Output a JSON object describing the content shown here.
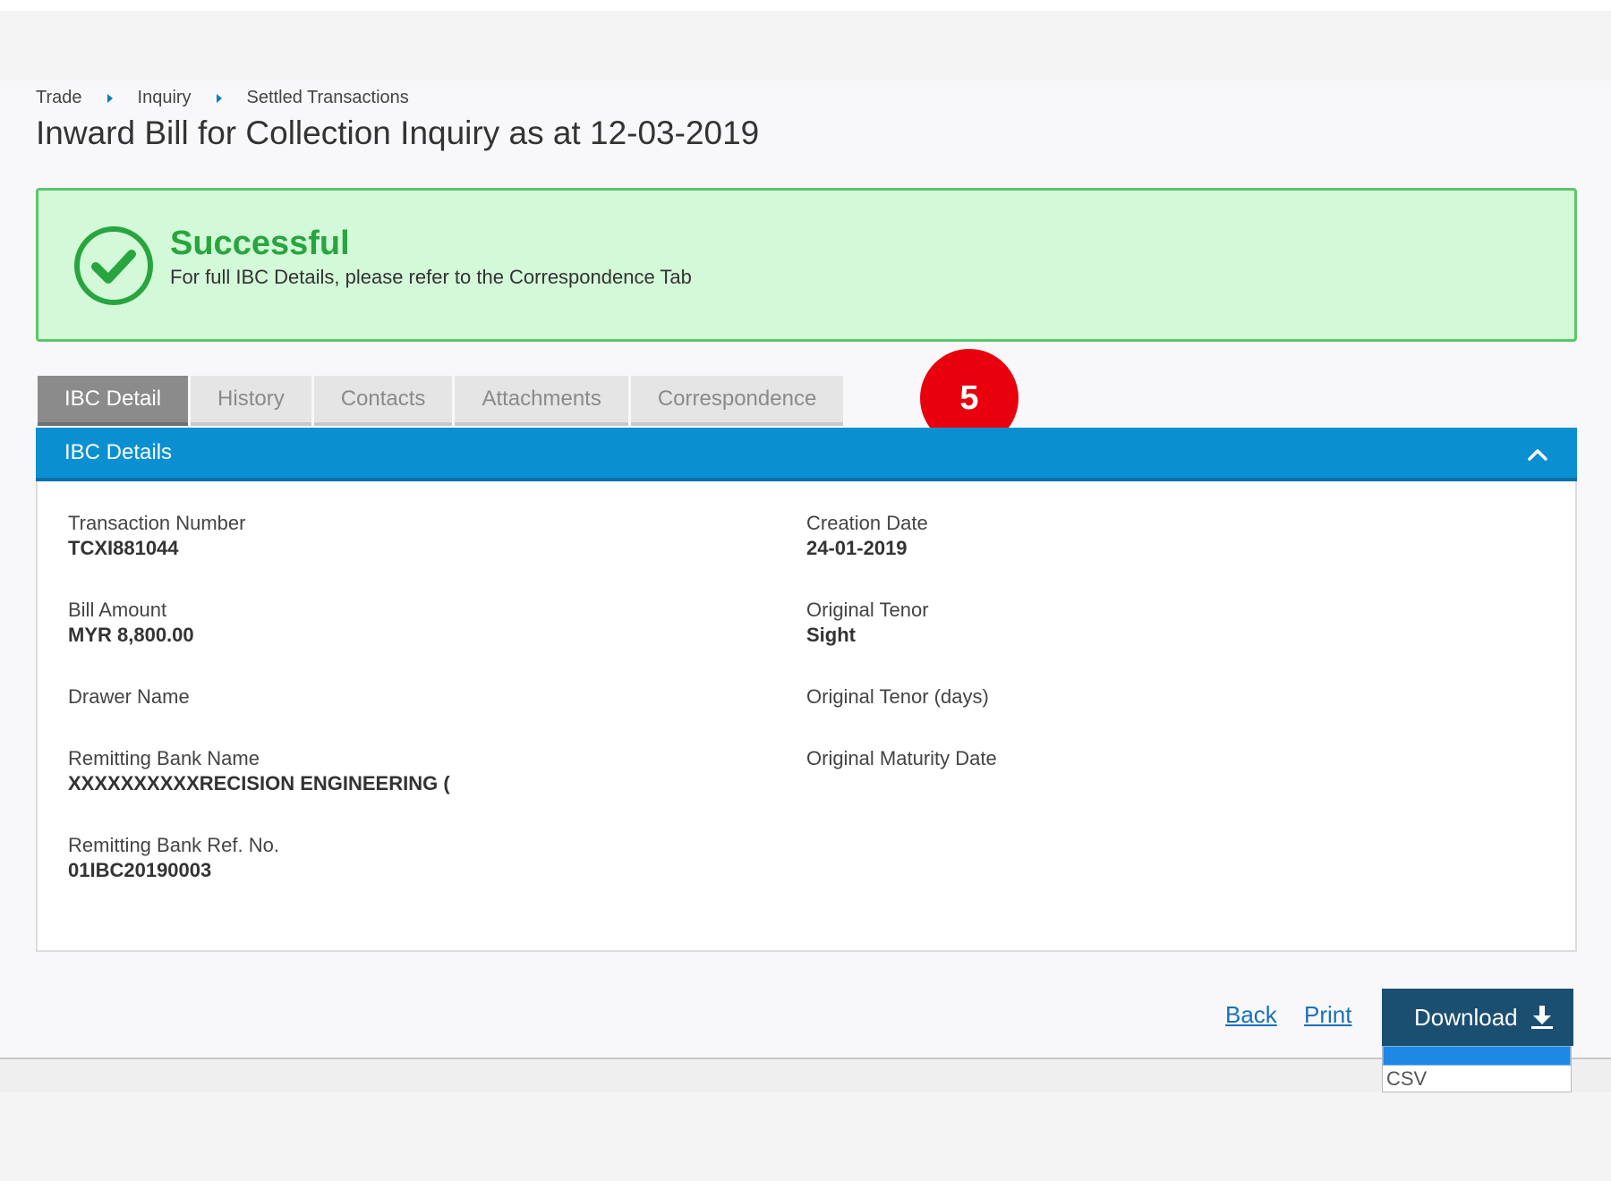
{
  "breadcrumb": [
    "Trade",
    "Inquiry",
    "Settled Transactions"
  ],
  "page_title": "Inward Bill for Collection Inquiry as at 12-03-2019",
  "banner": {
    "title": "Successful",
    "message": "For full IBC Details, please refer to the Correspondence Tab",
    "icon": "check-circle-icon",
    "color": "#29a53f"
  },
  "tabs": [
    {
      "label": "IBC Detail",
      "active": true
    },
    {
      "label": "History",
      "active": false
    },
    {
      "label": "Contacts",
      "active": false
    },
    {
      "label": "Attachments",
      "active": false
    },
    {
      "label": "Correspondence",
      "active": false
    }
  ],
  "step_badge": "5",
  "section": {
    "title": "IBC Details",
    "toggle_icon": "chevron-up-icon",
    "fields": {
      "transaction_number": {
        "label": "Transaction Number",
        "value": "TCXI881044"
      },
      "creation_date": {
        "label": "Creation Date",
        "value": "24-01-2019"
      },
      "bill_amount": {
        "label": "Bill Amount",
        "value": "MYR 8,800.00"
      },
      "original_tenor": {
        "label": "Original Tenor",
        "value": "Sight"
      },
      "drawer_name": {
        "label": "Drawer Name",
        "value": ""
      },
      "original_tenor_days": {
        "label": "Original Tenor (days)",
        "value": ""
      },
      "remitting_bank_name": {
        "label": "Remitting Bank Name",
        "value": "XXXXXXXXXXRECISION ENGINEERING ("
      },
      "original_maturity_date": {
        "label": "Original Maturity Date",
        "value": ""
      },
      "remitting_bank_ref": {
        "label": "Remitting Bank Ref. No.",
        "value": "01IBC20190003"
      }
    }
  },
  "actions": {
    "back_label": "Back",
    "print_label": "Print",
    "download_label": "Download",
    "download_icon": "download-icon",
    "download_options": [
      "CSV"
    ]
  },
  "colors": {
    "accent": "#0a90d0",
    "banner_bg": "#d3f9d9",
    "badge": "#e8000d",
    "download_bg": "#1b4f72"
  }
}
